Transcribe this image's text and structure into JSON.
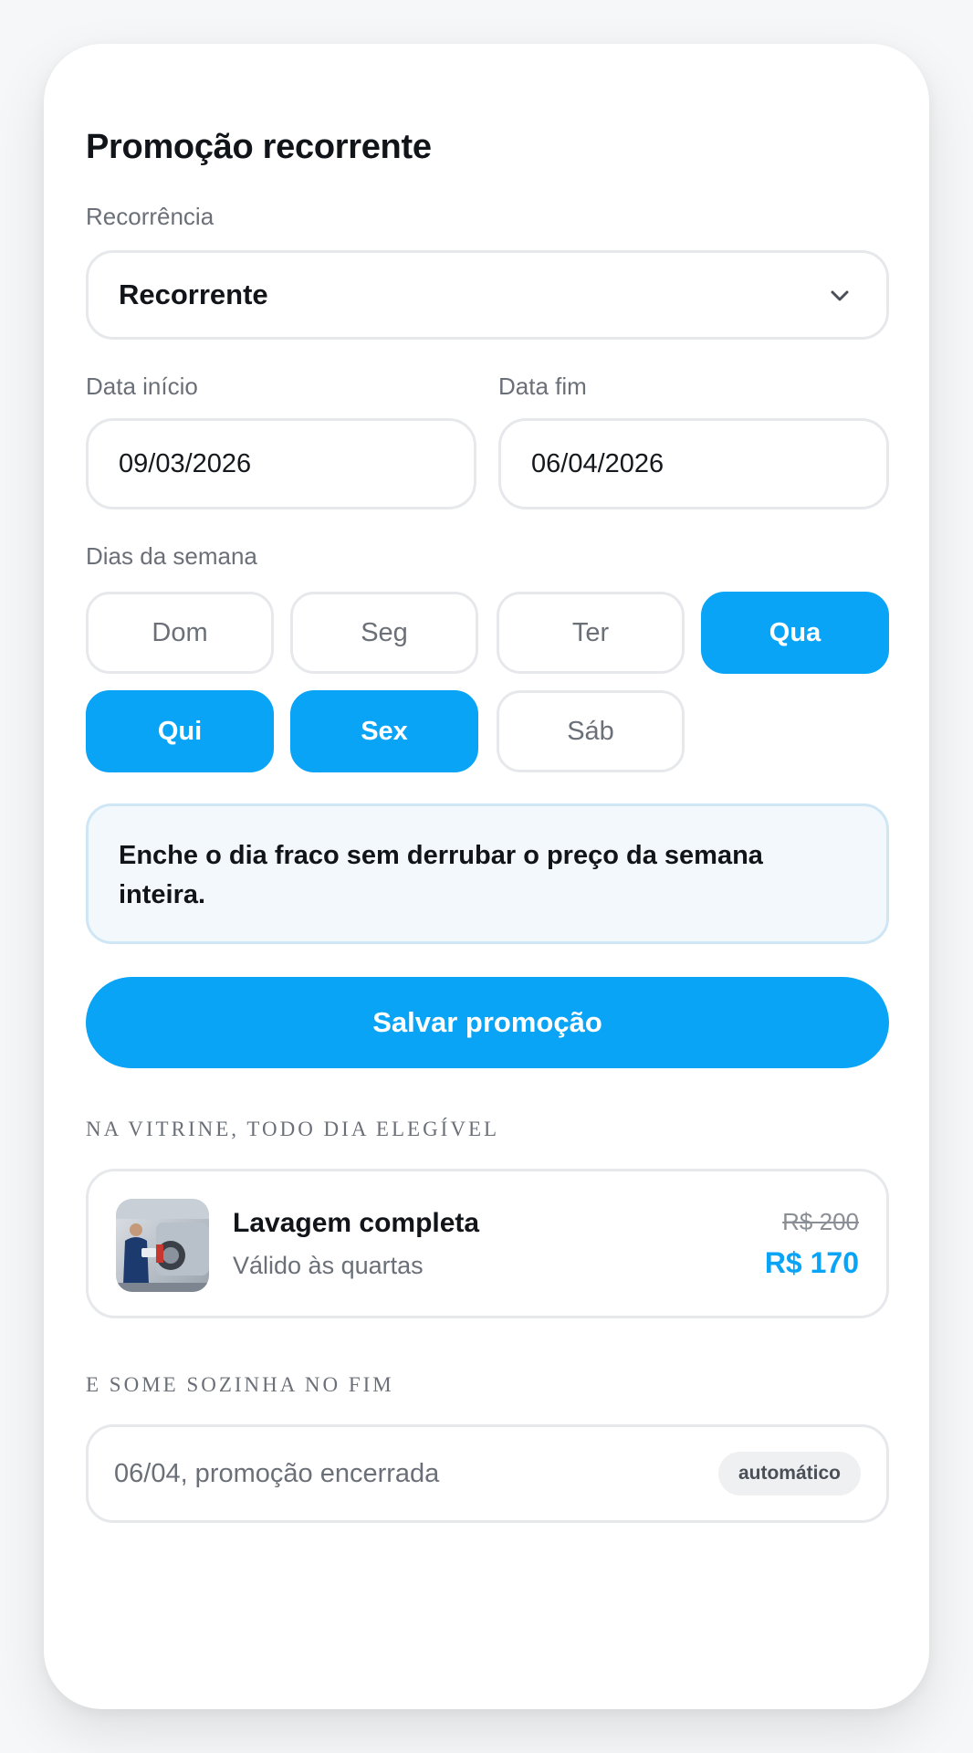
{
  "title": "Promoção recorrente",
  "recurrence": {
    "label": "Recorrência",
    "value": "Recorrente",
    "icon": "chevron-down-icon"
  },
  "dates": {
    "start_label": "Data início",
    "start_value": "09/03/2026",
    "end_label": "Data fim",
    "end_value": "06/04/2026"
  },
  "weekdays": {
    "label": "Dias da semana",
    "days": [
      {
        "label": "Dom",
        "selected": false
      },
      {
        "label": "Seg",
        "selected": false
      },
      {
        "label": "Ter",
        "selected": false
      },
      {
        "label": "Qua",
        "selected": true
      },
      {
        "label": "Qui",
        "selected": true
      },
      {
        "label": "Sex",
        "selected": true
      },
      {
        "label": "Sáb",
        "selected": false
      }
    ]
  },
  "note": "Enche o dia fraco sem derrubar o preço da semana inteira.",
  "save_label": "Salvar promoção",
  "showcase": {
    "label": "NA VITRINE, TODO DIA ELEGÍVEL",
    "product": {
      "name": "Lavagem completa",
      "subtitle": "Válido às quartas",
      "old_price": "R$ 200",
      "new_price": "R$ 170"
    }
  },
  "end": {
    "label": "E SOME SOZINHA NO FIM",
    "text": "06/04, promoção encerrada",
    "badge": "automático"
  },
  "colors": {
    "accent": "#0aa4f7",
    "note_bg": "#f3f8fd",
    "muted": "#6b7078"
  }
}
